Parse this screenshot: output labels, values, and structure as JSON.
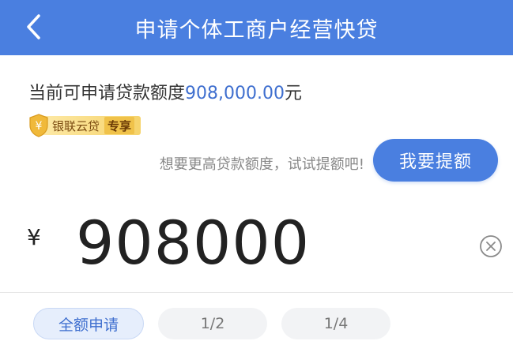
{
  "header": {
    "title": "申请个体工商户经营快贷",
    "background": "#4a7fe0"
  },
  "quota": {
    "label": "当前可申请贷款额度",
    "amount": "908,000.00",
    "unit": "元"
  },
  "badge": {
    "icon_glyph": "¥",
    "name": "银联云贷",
    "tag": "专享"
  },
  "raise": {
    "hint": "想要更高贷款额度，试试提额吧!",
    "button_label": "我要提额"
  },
  "amount_input": {
    "currency": "¥",
    "value": "908000"
  },
  "chips": [
    {
      "label": "全额申请",
      "selected": true
    },
    {
      "label": "1/2",
      "selected": false
    },
    {
      "label": "1/4",
      "selected": false
    }
  ],
  "colors": {
    "accent": "#4a7fe0",
    "amount_text": "#3f6fcf"
  }
}
